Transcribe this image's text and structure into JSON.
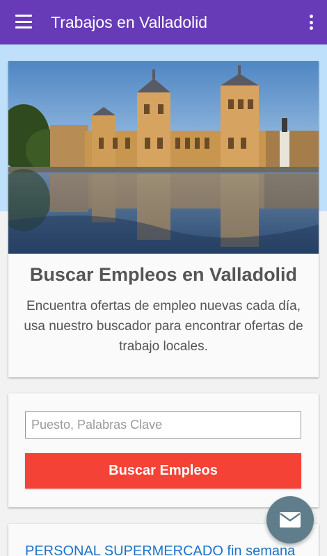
{
  "appbar": {
    "title": "Trabajos en Valladolid",
    "menu_icon": "hamburger-menu-icon",
    "more_icon": "more-vert-icon",
    "color": "#673ab7"
  },
  "hero": {
    "title": "Buscar Empleos en Valladolid",
    "description": "Encuentra ofertas de empleo nuevas cada día, usa nuestro buscador para encontrar ofertas de trabajo locales."
  },
  "search": {
    "placeholder": "Puesto, Palabras Clave",
    "value": "",
    "button_label": "Buscar Empleos",
    "button_color": "#f44336"
  },
  "jobs": [
    {
      "title": "PERSONAL SUPERMERCADO fin semana"
    }
  ],
  "fab": {
    "icon": "mail-icon",
    "color": "#607d8b"
  }
}
